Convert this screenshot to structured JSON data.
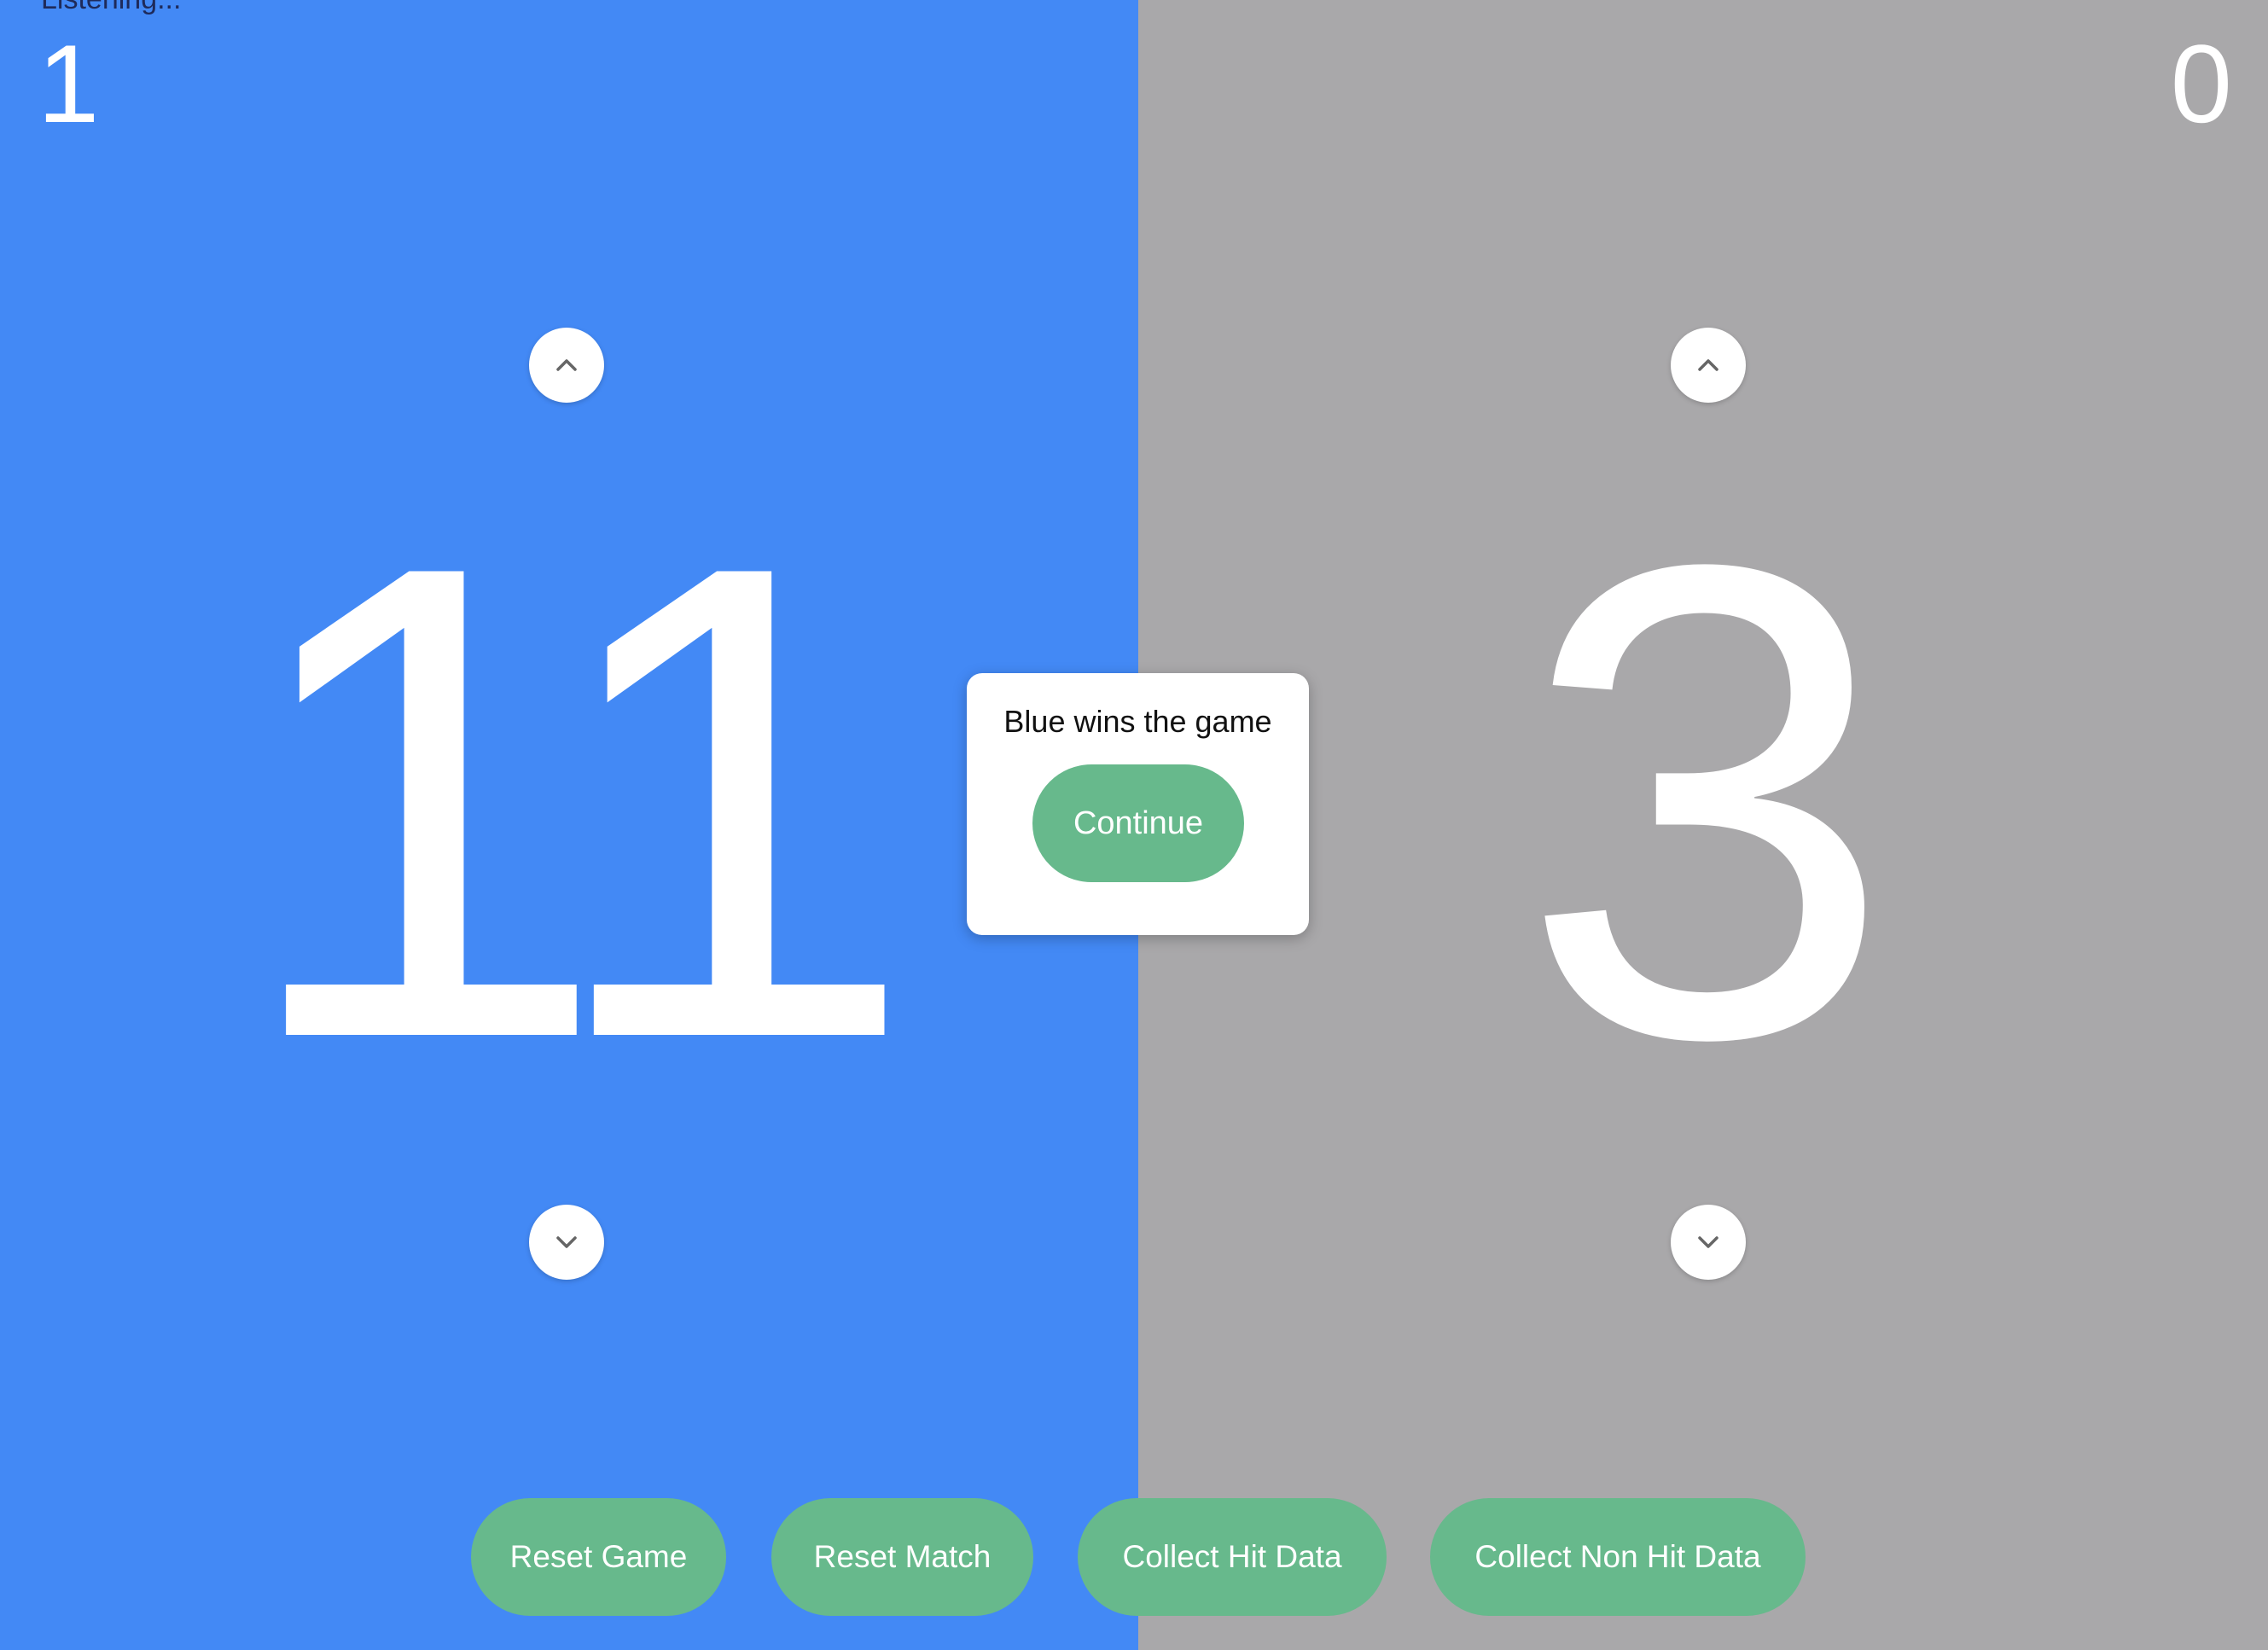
{
  "status": {
    "text": "Listening..."
  },
  "colors": {
    "blue_panel": "#4389f5",
    "gray_panel": "#a9a8aa",
    "button_green": "#67b98c",
    "white": "#ffffff"
  },
  "players": {
    "left": {
      "match_score": "1",
      "game_score": "11",
      "increment_icon": "chevron-up-icon",
      "decrement_icon": "chevron-down-icon"
    },
    "right": {
      "match_score": "0",
      "game_score": "3",
      "increment_icon": "chevron-up-icon",
      "decrement_icon": "chevron-down-icon"
    }
  },
  "dialog": {
    "message": "Blue wins the game",
    "continue_label": "Continue"
  },
  "toolbar": {
    "reset_game_label": "Reset Game",
    "reset_match_label": "Reset Match",
    "collect_hit_label": "Collect Hit Data",
    "collect_non_hit_label": "Collect Non Hit Data"
  }
}
